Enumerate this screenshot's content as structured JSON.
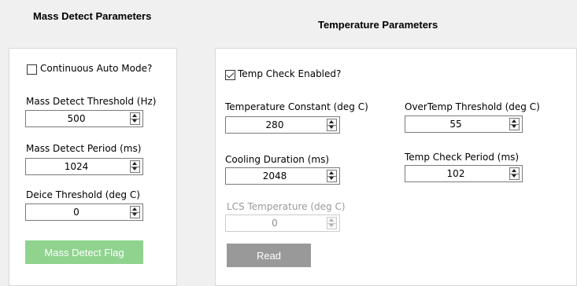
{
  "mass_detect": {
    "heading": "Mass Detect Parameters",
    "continuous_auto_mode": {
      "label": "Continuous Auto Mode?",
      "checked": false
    },
    "threshold": {
      "label": "Mass Detect Threshold (Hz)",
      "value": "500"
    },
    "period": {
      "label": "Mass Detect Period (ms)",
      "value": "1024"
    },
    "deice": {
      "label": "Deice Threshold (deg C)",
      "value": "0"
    },
    "flag_button": {
      "label": "Mass Detect Flag",
      "color": "#8fd38f"
    }
  },
  "temperature": {
    "heading": "Temperature Parameters",
    "temp_check_enabled": {
      "label": "Temp Check Enabled?",
      "checked": true
    },
    "temp_constant": {
      "label": "Temperature Constant (deg C)",
      "value": "280"
    },
    "overtemp": {
      "label": "OverTemp Threshold (deg C)",
      "value": "55"
    },
    "cooling": {
      "label": "Cooling Duration (ms)",
      "value": "2048"
    },
    "check_period": {
      "label": "Temp Check Period (ms)",
      "value": "102"
    },
    "lcs": {
      "label": "LCS Temperature (deg C)",
      "value": "0",
      "disabled": true
    },
    "read_button": {
      "label": "Read",
      "color": "#999999"
    }
  }
}
